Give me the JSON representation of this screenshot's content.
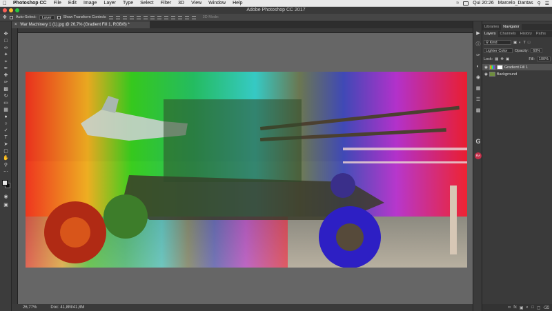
{
  "menubar": {
    "app": "Photoshop CC",
    "items": [
      "File",
      "Edit",
      "Image",
      "Layer",
      "Type",
      "Select",
      "Filter",
      "3D",
      "View",
      "Window",
      "Help"
    ],
    "clock": "Qui 20:26",
    "user": "Marcelo_Dantas"
  },
  "window": {
    "title": "Adobe Photoshop CC 2017"
  },
  "options": {
    "auto_select_label": "Auto-Select:",
    "auto_select_value": "Layer",
    "transform_label": "Show Transform Controls",
    "mode_3d": "3D Mode:"
  },
  "document": {
    "tab_title": "War Machinery 1 (1).jpg @ 26,7% (Gradient Fill 1, RGB/8) *"
  },
  "status": {
    "zoom": "26,77%",
    "doc": "Doc: 41,8M/41,8M"
  },
  "panels": {
    "top_tabs": [
      "Libraries",
      "Navigator"
    ],
    "layer_tabs": [
      "Layers",
      "Channels",
      "History",
      "Paths"
    ],
    "filter_kind": "Kind",
    "blend_mode": "Lighter Color",
    "opacity_label": "Opacity:",
    "opacity_value": "60%",
    "lock_label": "Lock:",
    "fill_label": "Fill:",
    "fill_value": "100%",
    "layers": [
      {
        "name": "Gradient Fill 1"
      },
      {
        "name": "Background"
      }
    ]
  },
  "colors": {
    "accent": "#2d8ceb",
    "panel": "#3a3a3a",
    "pasteboard": "#666666"
  }
}
